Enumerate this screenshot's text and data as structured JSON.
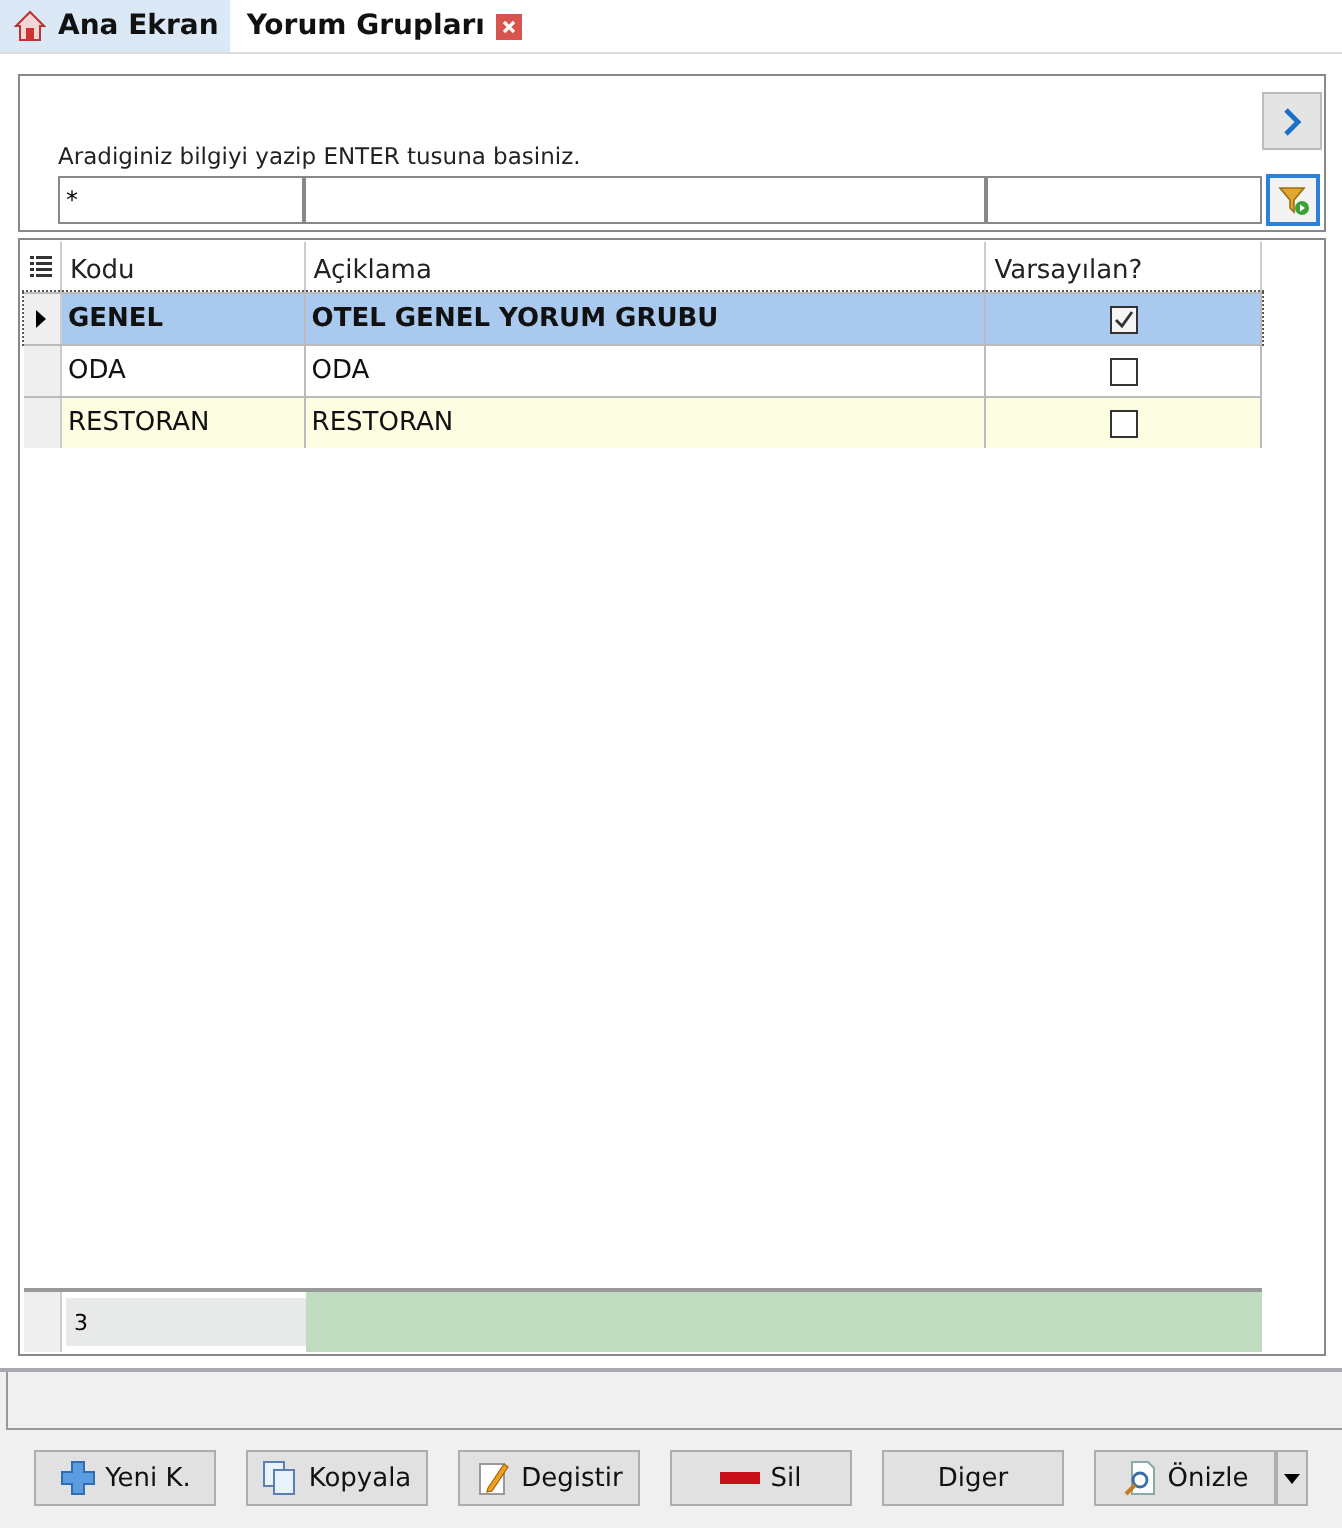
{
  "tabs": [
    {
      "label": "Ana Ekran",
      "selected": false,
      "closable": false
    },
    {
      "label": "Yorum Grupları",
      "selected": true,
      "closable": true
    }
  ],
  "search": {
    "hint": "Aradiginiz bilgiyi yazip ENTER tusuna basiniz.",
    "fields": [
      {
        "kind": "filter",
        "value": "*"
      },
      {
        "kind": "filter"
      },
      {
        "kind": "filter"
      }
    ]
  },
  "table": {
    "columns": [
      "Kodu",
      "Açiklama",
      "Varsayılan?"
    ],
    "rows": [
      {
        "code": "GENEL",
        "description": "OTEL GENEL YORUM GRUBU",
        "default": true,
        "selected": true
      },
      {
        "code": "ODA",
        "description": "ODA",
        "default": false,
        "selected": false
      },
      {
        "code": "RESTORAN",
        "description": "RESTORAN",
        "default": false,
        "selected": false
      }
    ],
    "footer_count": "3"
  },
  "buttons": [
    {
      "label": "Yeni K.",
      "kind": "plus"
    },
    {
      "label": "Kopyala",
      "kind": "copy"
    },
    {
      "label": "Degistir",
      "kind": "edit"
    },
    {
      "label": "Sil",
      "kind": "minus"
    },
    {
      "label": "Diger",
      "kind": "none"
    },
    {
      "label": "Önizle",
      "kind": "preview"
    }
  ]
}
